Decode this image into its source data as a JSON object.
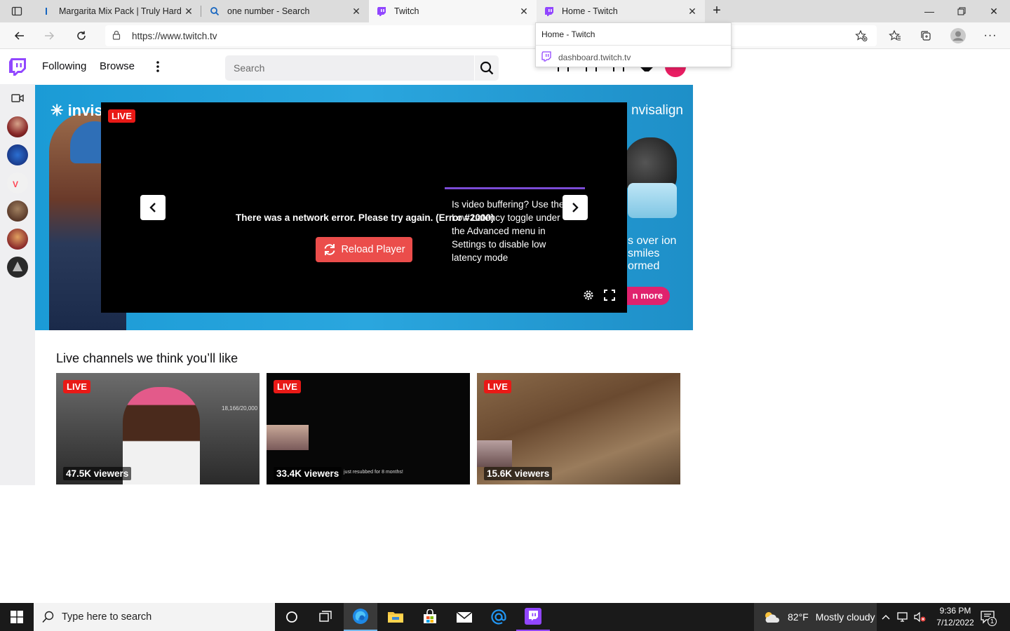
{
  "browser": {
    "tabs": [
      {
        "title": "Margarita Mix Pack | Truly Hard S",
        "favicon": "truly-icon"
      },
      {
        "title": "one number - Search",
        "favicon": "bing-search-icon"
      },
      {
        "title": "Twitch",
        "favicon": "twitch-icon"
      },
      {
        "title": "Home - Twitch",
        "favicon": "twitch-icon"
      }
    ],
    "new_tab": "+",
    "url": "https://www.twitch.tv",
    "hover_card": {
      "title": "Home - Twitch",
      "url": "dashboard.twitch.tv"
    }
  },
  "twitch": {
    "nav": {
      "following": "Following",
      "browse": "Browse"
    },
    "search": {
      "placeholder": "Search"
    },
    "colors": {
      "brand": "#9146ff",
      "live": "#e91916",
      "reload": "#eb4d4b"
    }
  },
  "hero": {
    "ad_brand_left": "invis",
    "ad_brand_right": "nvisalign",
    "ad_text": "s over ion smiles ormed",
    "ad_button": "n more",
    "player": {
      "live": "LIVE",
      "error": "There was a network error. Please try again. (Error #2000)",
      "reload": "Reload Player",
      "tip": "Is video buffering? Use the Low Latency toggle under the Advanced menu in Settings to disable low latency mode"
    }
  },
  "live_section": {
    "title": "Live channels we think you’ll like",
    "channels": [
      {
        "live": "LIVE",
        "viewers": "47.5K viewers",
        "overlay": "18,166/20,000"
      },
      {
        "live": "LIVE",
        "viewers": "33.4K viewers",
        "overlay": "just resubbed for 8 months!"
      },
      {
        "live": "LIVE",
        "viewers": "15.6K viewers"
      }
    ]
  },
  "taskbar": {
    "search_placeholder": "Type here to search",
    "weather": {
      "temp": "82°F",
      "condition": "Mostly cloudy"
    },
    "time": "9:36 PM",
    "date": "7/12/2022",
    "notification_count": "1"
  }
}
